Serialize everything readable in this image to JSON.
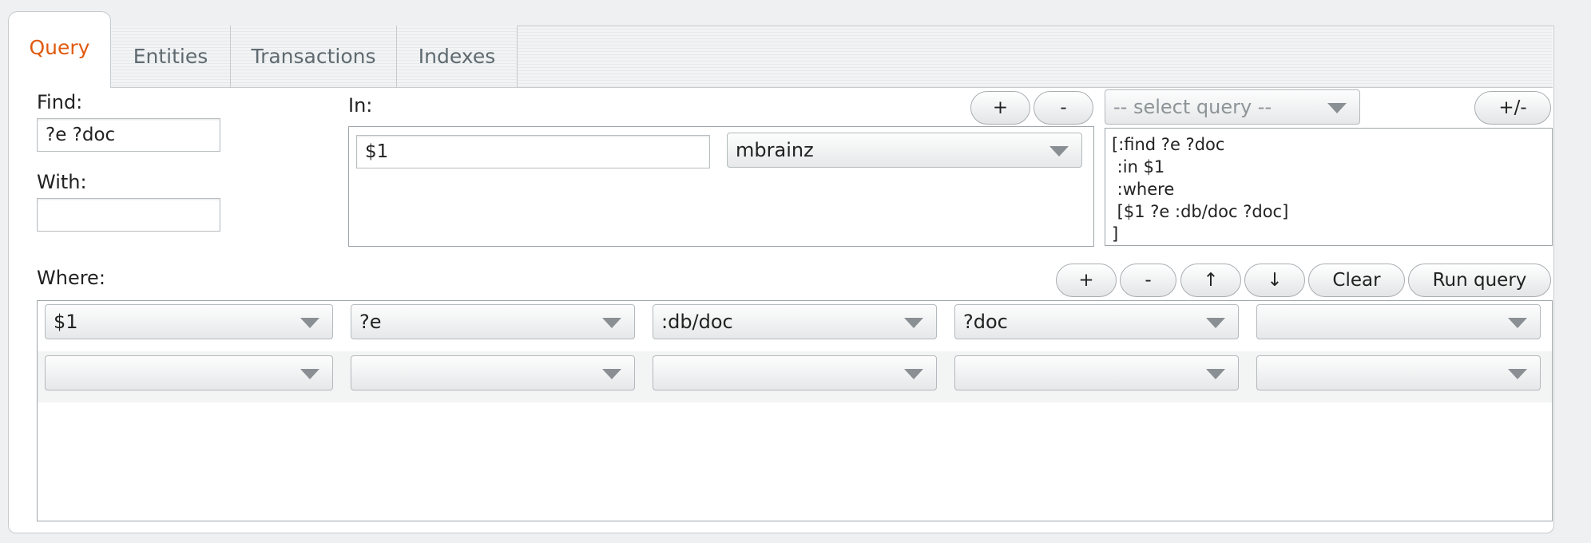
{
  "tabs": [
    {
      "label": "Query",
      "active": true
    },
    {
      "label": "Entities",
      "active": false
    },
    {
      "label": "Transactions",
      "active": false
    },
    {
      "label": "Indexes",
      "active": false
    }
  ],
  "find": {
    "label": "Find:",
    "value": "?e ?doc"
  },
  "with": {
    "label": "With:",
    "value": ""
  },
  "in": {
    "label": "In:",
    "add_button": "+",
    "remove_button": "-",
    "input_value": "$1",
    "source_value": "mbrainz"
  },
  "query_select": {
    "placeholder": "-- select query --",
    "toggle_button": "+/-"
  },
  "editor": {
    "text": "[:find ?e ?doc\n :in $1\n :where\n [$1 ?e :db/doc ?doc]\n]"
  },
  "where": {
    "label": "Where:",
    "buttons": {
      "add": "+",
      "remove": "-",
      "up": "↑",
      "down": "↓",
      "clear": "Clear",
      "run": "Run query"
    },
    "rows": [
      [
        "$1",
        "?e",
        ":db/doc",
        "?doc",
        ""
      ],
      [
        "",
        "",
        "",
        "",
        ""
      ]
    ]
  },
  "colors": {
    "active_tab": "#e05a10",
    "text": "#222222",
    "border": "#9ea5a9"
  }
}
